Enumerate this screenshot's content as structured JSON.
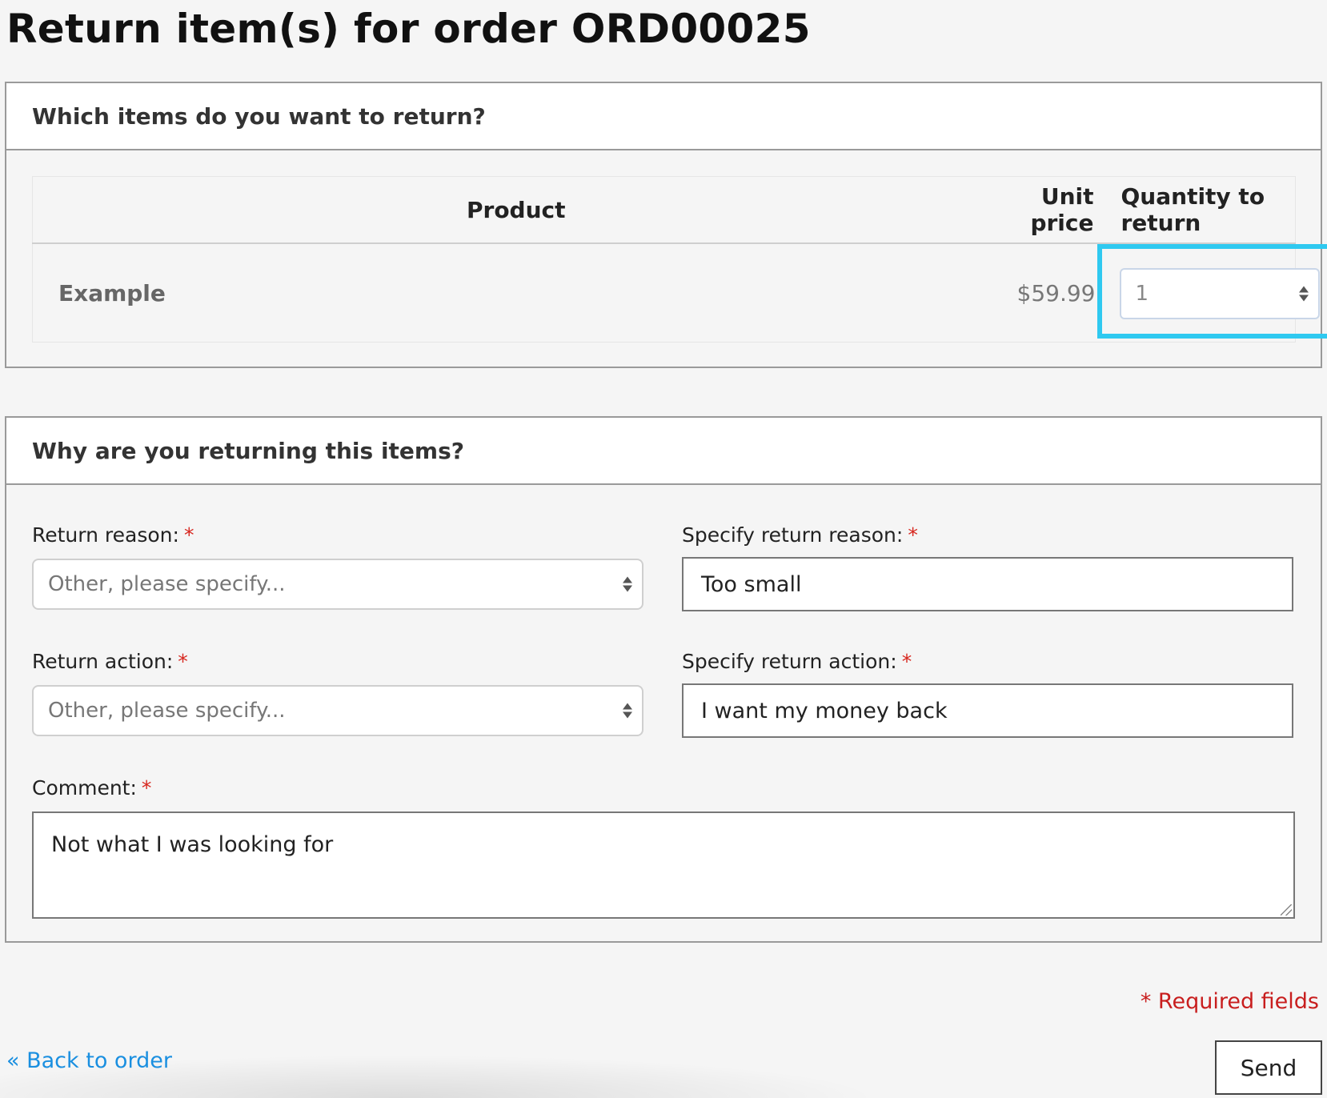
{
  "page": {
    "title": "Return item(s) for order ORD00025"
  },
  "items_section": {
    "heading": "Which items do you want to return?",
    "columns": {
      "product": "Product",
      "unit_price": "Unit price",
      "quantity": "Quantity to return"
    },
    "rows": [
      {
        "product": "Example",
        "unit_price": "$59.99",
        "quantity": "1"
      }
    ],
    "highlight_color": "#2fc9f0"
  },
  "reason_section": {
    "heading": "Why are you returning this items?",
    "return_reason": {
      "label": "Return reason:",
      "value": "Other, please specify..."
    },
    "specify_reason": {
      "label": "Specify return reason:",
      "value": "Too small"
    },
    "return_action": {
      "label": "Return action:",
      "value": "Other, please specify..."
    },
    "specify_action": {
      "label": "Specify return action:",
      "value": "I want my money back"
    },
    "comment": {
      "label": "Comment:",
      "value": "Not what I was looking for"
    },
    "required_marker": "*"
  },
  "footer": {
    "required_note": "* Required fields",
    "back_link": "« Back to order",
    "send_label": "Send"
  },
  "colors": {
    "required": "#d7261e",
    "link": "#1a8fe0"
  }
}
